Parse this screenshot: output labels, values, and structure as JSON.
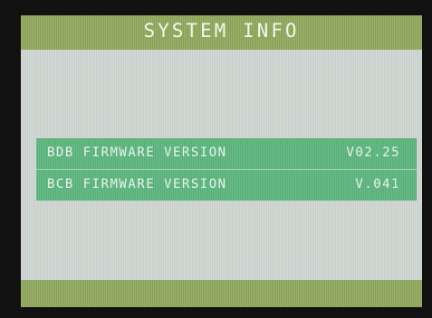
{
  "header": {
    "title": "SYSTEM INFO"
  },
  "info": {
    "rows": [
      {
        "label": "BDB FIRMWARE VERSION",
        "value": "V02.25"
      },
      {
        "label": "BCB FIRMWARE VERSION",
        "value": "V.041"
      }
    ]
  },
  "colors": {
    "title_bar": "#8fa95c",
    "screen_background": "#cfd6d2",
    "info_panel": "#5cb67e",
    "text": "#f4f6ee"
  }
}
